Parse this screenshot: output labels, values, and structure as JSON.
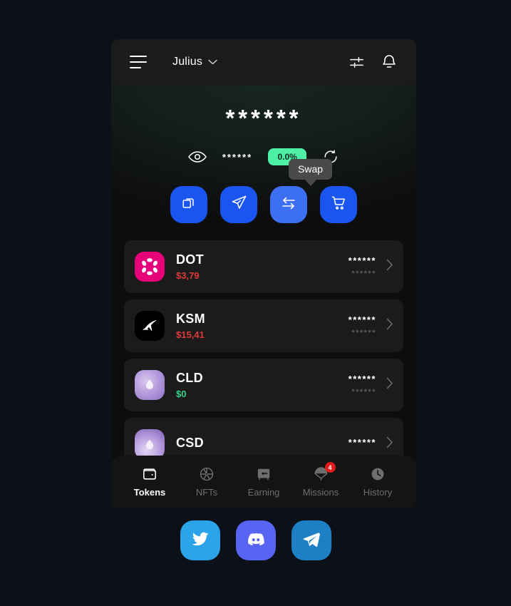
{
  "header": {
    "menu_icon": "hamburger-icon",
    "account_name": "Julius",
    "chevron_icon": "chevron-down-icon",
    "settings_icon": "sliders-icon",
    "notifications_icon": "bell-icon"
  },
  "hero": {
    "balance_masked": "******",
    "eye_icon": "eye-icon",
    "sub_value_masked": "******",
    "change_badge": "0.0%",
    "refresh_icon": "refresh-icon",
    "badge_color": "#4ef0a6"
  },
  "actions": [
    {
      "name": "receive-button",
      "icon": "copy-squares-icon",
      "hovered": false
    },
    {
      "name": "send-button",
      "icon": "paper-plane-icon",
      "hovered": false
    },
    {
      "name": "swap-button",
      "icon": "swap-arrows-icon",
      "hovered": true
    },
    {
      "name": "buy-button",
      "icon": "shopping-cart-icon",
      "hovered": false
    }
  ],
  "tooltip": {
    "label": "Swap"
  },
  "tokens": [
    {
      "symbol": "DOT",
      "price": "$3,79",
      "price_state": "down",
      "logo": "polkadot-logo",
      "balance_masked": "******",
      "fiat_masked": "******"
    },
    {
      "symbol": "KSM",
      "price": "$15,41",
      "price_state": "down",
      "logo": "kusama-logo",
      "balance_masked": "******",
      "fiat_masked": "******"
    },
    {
      "symbol": "CLD",
      "price": "$0",
      "price_state": "zero",
      "logo": "cld-logo",
      "balance_masked": "******",
      "fiat_masked": "******"
    },
    {
      "symbol": "CSD",
      "price": "",
      "price_state": "zero",
      "logo": "csd-logo",
      "balance_masked": "******",
      "fiat_masked": ""
    }
  ],
  "bottom_nav": [
    {
      "label": "Tokens",
      "icon": "wallet-icon",
      "active": true,
      "badge": ""
    },
    {
      "label": "NFTs",
      "icon": "aperture-icon",
      "active": false,
      "badge": ""
    },
    {
      "label": "Earning",
      "icon": "safe-icon",
      "active": false,
      "badge": ""
    },
    {
      "label": "Missions",
      "icon": "parachute-icon",
      "active": false,
      "badge": "4"
    },
    {
      "label": "History",
      "icon": "clock-icon",
      "active": false,
      "badge": ""
    }
  ],
  "socials": [
    {
      "name": "twitter-button",
      "icon": "twitter-icon",
      "color": "#2aa3e8"
    },
    {
      "name": "discord-button",
      "icon": "discord-icon",
      "color": "#5865f2"
    },
    {
      "name": "telegram-button",
      "icon": "telegram-icon",
      "color": "#1d7fc4"
    }
  ]
}
